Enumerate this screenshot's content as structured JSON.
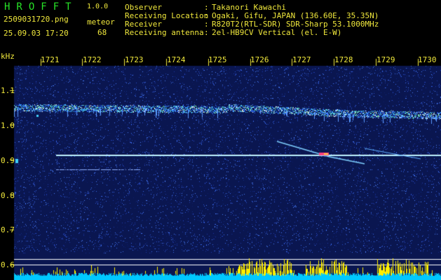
{
  "app": {
    "brand": "HROFFT",
    "version": "1.0.0",
    "filename": "2509031720.png",
    "datetime": "25.09.03 17:20",
    "meteor_label": "meteor",
    "meteor_count": "68"
  },
  "info": [
    {
      "label": "Observer",
      "value": "Takanori Kawachi"
    },
    {
      "label": "Receiving Location",
      "value": "Ogaki, Gifu, JAPAN (136.60E, 35.35N)"
    },
    {
      "label": "Receiver",
      "value": "R820T2(RTL-SDR) SDR-Sharp 53.1000MHz"
    },
    {
      "label": "Receiving antenna",
      "value": "2el-HB9CV Vertical (el. E-W)"
    }
  ],
  "spectrogram": {
    "y_unit": "kHz",
    "y_ticks": [
      "1.1",
      "1.0",
      "0.9",
      "0.8",
      "0.7",
      "0.6"
    ],
    "x_ticks": [
      "1721",
      "1722",
      "1723",
      "1724",
      "1725",
      "1726",
      "1727",
      "1728",
      "1729",
      "1730"
    ],
    "colors": {
      "background": "#0a1650",
      "noise": "#1e3aa8",
      "carrier": "#9fe8ff",
      "echo": "#ff4080",
      "baseline": "#00c8ff",
      "peaks": "#ffee00"
    }
  }
}
